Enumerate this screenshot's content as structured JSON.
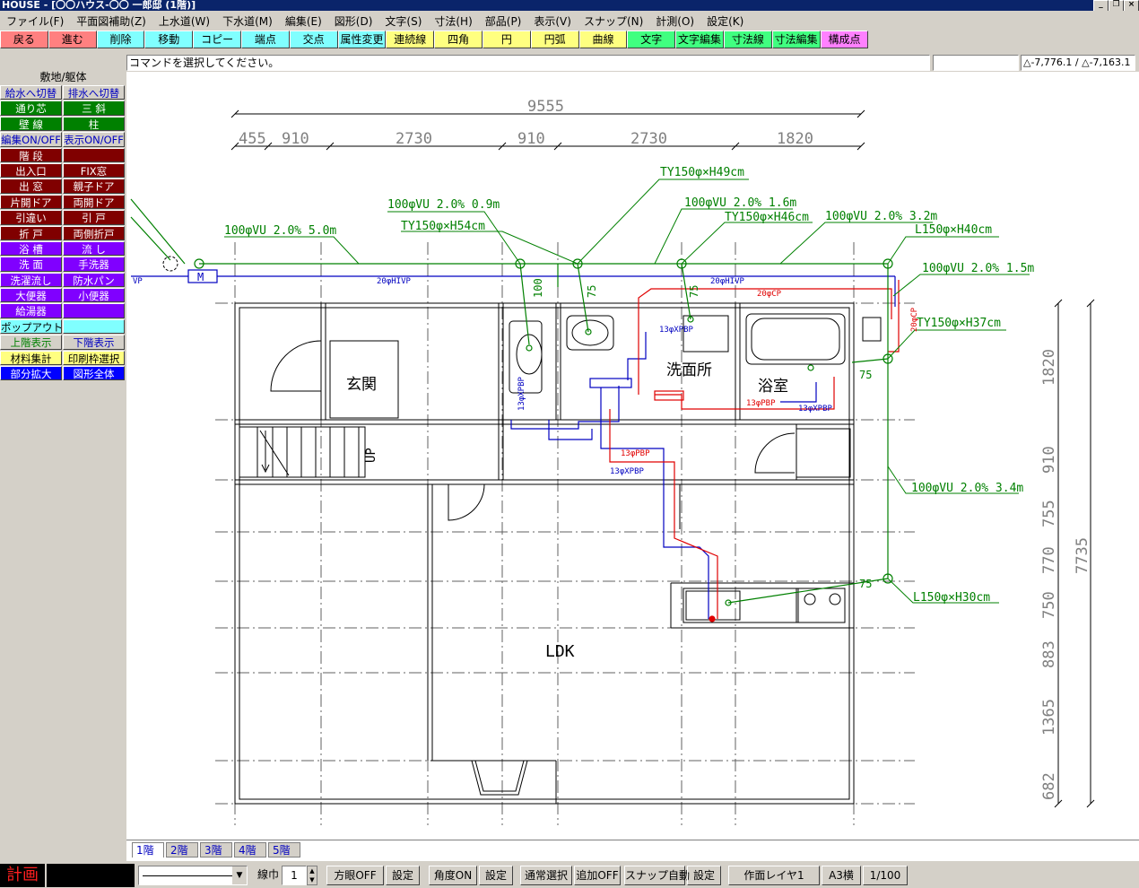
{
  "window": {
    "title": "HOUSE - [〇〇ハウス-〇〇 一郎邸 (1階)]",
    "min_glyph": "_",
    "restore_glyph": "❐",
    "close_glyph": "×"
  },
  "menu": [
    "ファイル(F)",
    "平面図補助(Z)",
    "上水道(W)",
    "下水道(M)",
    "編集(E)",
    "図形(D)",
    "文字(S)",
    "寸法(H)",
    "部品(P)",
    "表示(V)",
    "スナップ(N)",
    "計測(O)",
    "設定(K)"
  ],
  "toolbar": [
    {
      "label": "戻る",
      "color": "#ff8080"
    },
    {
      "label": "進む",
      "color": "#ff8080"
    },
    {
      "label": "削除",
      "color": "#80ffff"
    },
    {
      "label": "移動",
      "color": "#80ffff"
    },
    {
      "label": "コピー",
      "color": "#80ffff"
    },
    {
      "label": "端点",
      "color": "#80ffff"
    },
    {
      "label": "交点",
      "color": "#80ffff"
    },
    {
      "label": "属性変更",
      "color": "#80ffff"
    },
    {
      "label": "連続線",
      "color": "#ffff80"
    },
    {
      "label": "四角",
      "color": "#ffff80"
    },
    {
      "label": "円",
      "color": "#ffff80"
    },
    {
      "label": "円弧",
      "color": "#ffff80"
    },
    {
      "label": "曲線",
      "color": "#ffff80"
    },
    {
      "label": "文字",
      "color": "#40ff80"
    },
    {
      "label": "文字編集",
      "color": "#40ff80"
    },
    {
      "label": "寸法線",
      "color": "#40ff80"
    },
    {
      "label": "寸法編集",
      "color": "#40ff80"
    },
    {
      "label": "構成点",
      "color": "#ff80ff"
    }
  ],
  "command": {
    "prompt": "コマンドを選択してください。",
    "input_value": "",
    "coords": "△-7,776.1 / △-7,163.1"
  },
  "sidebar": {
    "header": "敷地/躯体",
    "rows": [
      [
        {
          "label": "給水へ切替",
          "bg": "#d4d0c8",
          "fg": "#0000c0"
        },
        {
          "label": "排水へ切替",
          "bg": "#d4d0c8",
          "fg": "#0000c0"
        }
      ],
      [
        {
          "label": "通り芯",
          "bg": "#008000",
          "fg": "#ffffff"
        },
        {
          "label": "三 斜",
          "bg": "#008000",
          "fg": "#ffffff"
        }
      ],
      [
        {
          "label": "壁 線",
          "bg": "#008000",
          "fg": "#ffffff"
        },
        {
          "label": "柱",
          "bg": "#008000",
          "fg": "#ffffff"
        }
      ],
      [
        {
          "label": "編集ON/OFF",
          "bg": "#d4d0c8",
          "fg": "#0000c0"
        },
        {
          "label": "表示ON/OFF",
          "bg": "#d4d0c8",
          "fg": "#0000c0"
        }
      ],
      [
        {
          "label": "階 段",
          "bg": "#800000",
          "fg": "#ffffff"
        },
        {
          "label": "",
          "bg": "#800000",
          "fg": "#ffffff"
        }
      ],
      [
        {
          "label": "出入口",
          "bg": "#800000",
          "fg": "#ffffff"
        },
        {
          "label": "FIX窓",
          "bg": "#800000",
          "fg": "#ffffff"
        }
      ],
      [
        {
          "label": "出 窓",
          "bg": "#800000",
          "fg": "#ffffff"
        },
        {
          "label": "親子ドア",
          "bg": "#800000",
          "fg": "#ffffff"
        }
      ],
      [
        {
          "label": "片開ドア",
          "bg": "#800000",
          "fg": "#ffffff"
        },
        {
          "label": "両開ドア",
          "bg": "#800000",
          "fg": "#ffffff"
        }
      ],
      [
        {
          "label": "引違い",
          "bg": "#800000",
          "fg": "#ffffff"
        },
        {
          "label": "引 戸",
          "bg": "#800000",
          "fg": "#ffffff"
        }
      ],
      [
        {
          "label": "折 戸",
          "bg": "#800000",
          "fg": "#ffffff"
        },
        {
          "label": "両側折戸",
          "bg": "#800000",
          "fg": "#ffffff"
        }
      ],
      [
        {
          "label": "浴 槽",
          "bg": "#8000ff",
          "fg": "#ffffff"
        },
        {
          "label": "流 し",
          "bg": "#8000ff",
          "fg": "#ffffff"
        }
      ],
      [
        {
          "label": "洗 面",
          "bg": "#8000ff",
          "fg": "#ffffff"
        },
        {
          "label": "手洗器",
          "bg": "#8000ff",
          "fg": "#ffffff"
        }
      ],
      [
        {
          "label": "洗濯流し",
          "bg": "#8000ff",
          "fg": "#ffffff"
        },
        {
          "label": "防水パン",
          "bg": "#8000ff",
          "fg": "#ffffff"
        }
      ],
      [
        {
          "label": "大便器",
          "bg": "#8000ff",
          "fg": "#ffffff"
        },
        {
          "label": "小便器",
          "bg": "#8000ff",
          "fg": "#ffffff"
        }
      ],
      [
        {
          "label": "給湯器",
          "bg": "#8000ff",
          "fg": "#ffffff"
        },
        {
          "label": "",
          "bg": "#8000ff",
          "fg": "#ffffff"
        }
      ],
      [
        {
          "label": "ポップアウト",
          "bg": "#80ffff",
          "fg": "#000000"
        },
        {
          "label": "",
          "bg": "#80ffff",
          "fg": "#000000"
        }
      ],
      [
        {
          "label": "上階表示",
          "bg": "#d4d0c8",
          "fg": "#008000"
        },
        {
          "label": "下階表示",
          "bg": "#d4d0c8",
          "fg": "#0000c0"
        }
      ],
      [
        {
          "label": "材料集計",
          "bg": "#ffff80",
          "fg": "#000000"
        },
        {
          "label": "印刷枠選択",
          "bg": "#ffff80",
          "fg": "#000000"
        }
      ],
      [
        {
          "label": "部分拡大",
          "bg": "#0000ff",
          "fg": "#ffffff"
        },
        {
          "label": "図形全体",
          "bg": "#0000ff",
          "fg": "#ffffff"
        }
      ]
    ]
  },
  "drawing": {
    "dims_top_total": "9555",
    "dims_top": [
      "455",
      "910",
      "2730",
      "910",
      "2730",
      "1820"
    ],
    "dims_right_total": "7735",
    "dims_right": [
      "1820",
      "910",
      "755",
      "770",
      "750",
      "883",
      "1365",
      "682"
    ],
    "rooms": [
      "玄関",
      "洗面所",
      "浴室",
      "LDK"
    ],
    "stair_label": "UP",
    "meter_label": "M",
    "pipe_labels": {
      "p1": "TY150φ×H49cm",
      "p2": "100φVU 2.0% 0.9m",
      "p3": "100φVU 2.0% 1.6m",
      "p4": "TY150φ×H46cm",
      "p5": "100φVU 2.0% 3.2m",
      "p6": "100φVU 2.0% 5.0m",
      "p7": "TY150φ×H54cm",
      "p8": "L150φ×H40cm",
      "p9": "100φVU 2.0% 1.5m",
      "p10": "TY150φ×H37cm",
      "p11": "100φVU 2.0% 3.4m",
      "p12": "L150φ×H30cm"
    },
    "small_labels": {
      "hivp": "20φHIVP",
      "hivp2": "20φHIVP",
      "vp": "VP",
      "cp": "20φCP",
      "cp2": "20φCP",
      "v100": "100",
      "v75a": "75",
      "v75b": "75",
      "v75c": "75",
      "v75d": "75",
      "xpbp1": "13φXPBP",
      "xpbp2": "13φXPBP",
      "xpbp3": "13φXPBP",
      "xpbp4": "13φXPBP",
      "pbp1": "13φPBP",
      "pbp2": "13φPBP"
    }
  },
  "page_tabs": [
    "1階",
    "2階",
    "3階",
    "4階",
    "5階"
  ],
  "status": {
    "mode": "計画",
    "line_width_label": "線巾",
    "line_width_value": "1",
    "grid": "方眼OFF",
    "set1": "設定",
    "angle": "角度ON",
    "set2": "設定",
    "select_mode": "通常選択",
    "add": "追加OFF",
    "snap": "スナップ自動",
    "set3": "設定",
    "layer": "作面レイヤ1",
    "paper": "A3横",
    "scale": "1/100"
  }
}
